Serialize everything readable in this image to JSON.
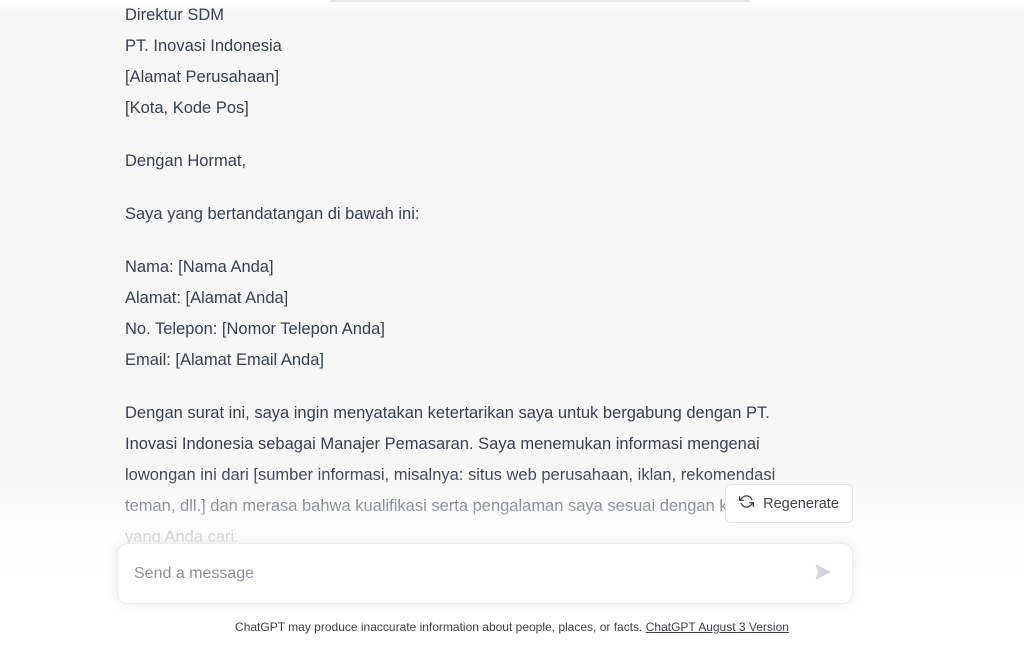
{
  "message": {
    "address_lines": [
      "Direktur SDM",
      "PT. Inovasi Indonesia",
      "[Alamat Perusahaan]",
      "[Kota, Kode Pos]"
    ],
    "greeting": "Dengan Hormat,",
    "intro": "Saya yang bertandatangan di bawah ini:",
    "info_lines": [
      "Nama: [Nama Anda]",
      "Alamat: [Alamat Anda]",
      "No. Telepon: [Nomor Telepon Anda]",
      "Email: [Alamat Email Anda]"
    ],
    "body_lines": [
      "Dengan surat ini, saya ingin menyatakan ketertarikan saya untuk bergabung dengan PT.",
      "Inovasi Indonesia sebagai Manajer Pemasaran. Saya menemukan informasi mengenai",
      "lowongan ini dari [sumber informasi, misalnya: situs web perusahaan, iklan, rekomendasi",
      "teman, dll.] dan merasa bahwa kualifikasi serta pengalaman saya sesuai dengan kriteria",
      "yang Anda cari."
    ]
  },
  "regenerate": {
    "label": "Regenerate",
    "icon": "refresh-icon"
  },
  "composer": {
    "placeholder": "Send a message",
    "send_icon": "send-icon"
  },
  "footer": {
    "disclaimer": "ChatGPT may produce inaccurate information about people, places, or facts.",
    "version_link": "ChatGPT August 3 Version"
  },
  "colors": {
    "text": "#374151",
    "background": "#f7f7f8",
    "placeholder": "#8e8ea0"
  }
}
